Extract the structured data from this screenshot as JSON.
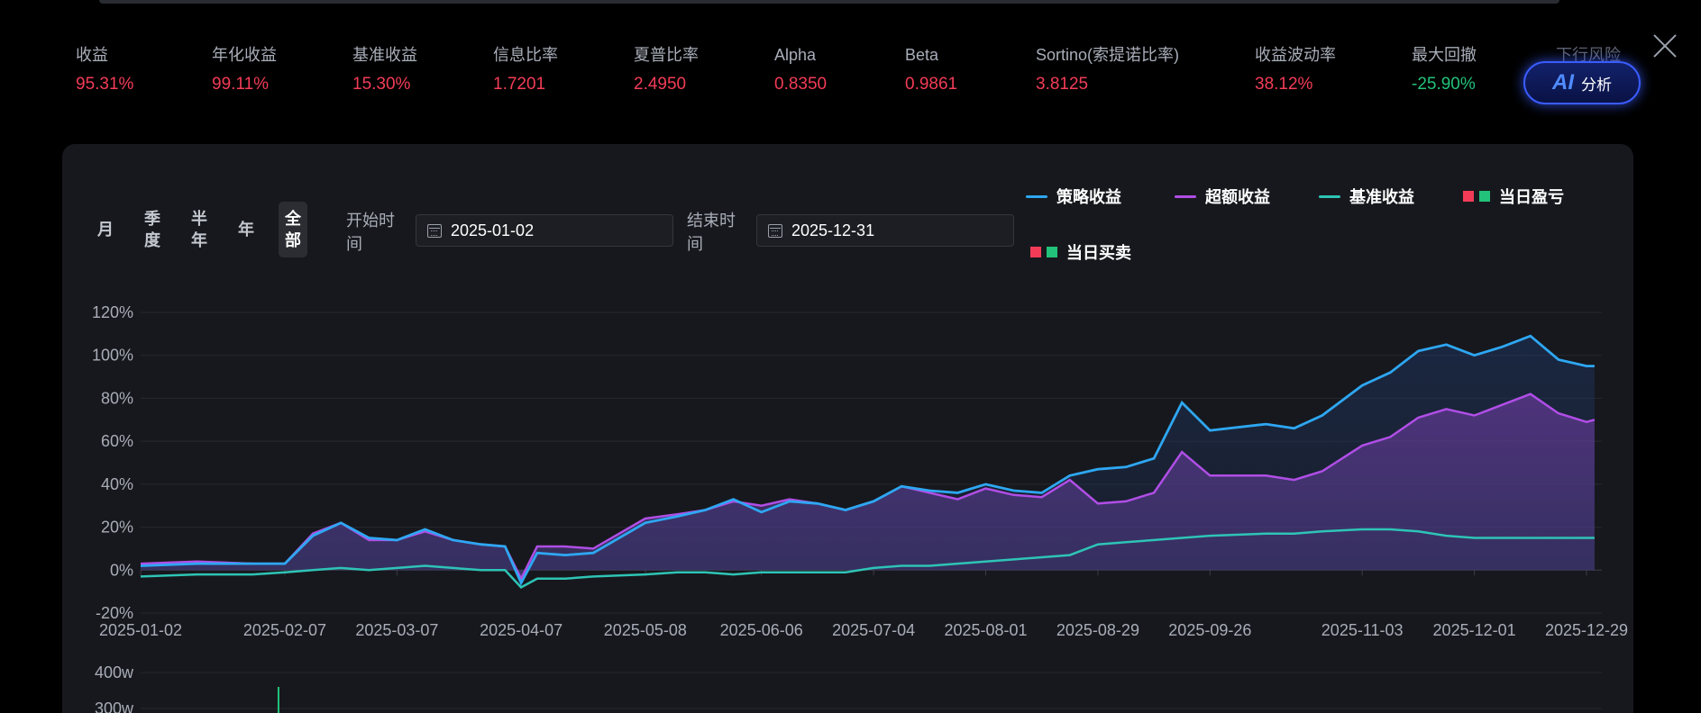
{
  "stats": [
    {
      "label": "收益",
      "value": "95.31%",
      "tone": "pos"
    },
    {
      "label": "年化收益",
      "value": "99.11%",
      "tone": "pos"
    },
    {
      "label": "基准收益",
      "value": "15.30%",
      "tone": "pos"
    },
    {
      "label": "信息比率",
      "value": "1.7201",
      "tone": "pos"
    },
    {
      "label": "夏普比率",
      "value": "2.4950",
      "tone": "pos"
    },
    {
      "label": "Alpha",
      "value": "0.8350",
      "tone": "pos"
    },
    {
      "label": "Beta",
      "value": "0.9861",
      "tone": "pos"
    },
    {
      "label": "Sortino(索提诺比率)",
      "value": "3.8125",
      "tone": "pos"
    },
    {
      "label": "收益波动率",
      "value": "38.12%",
      "tone": "pos"
    },
    {
      "label": "最大回撤",
      "value": "-25.90%",
      "tone": "neg"
    },
    {
      "label": "下行风险",
      "value": "",
      "tone": "faded"
    }
  ],
  "ai_button": {
    "mark": "AI",
    "label": "分析"
  },
  "period_tabs": [
    {
      "label": "月",
      "active": false
    },
    {
      "label": "季度",
      "active": false
    },
    {
      "label": "半年",
      "active": false
    },
    {
      "label": "年",
      "active": false
    },
    {
      "label": "全部",
      "active": true
    }
  ],
  "date_range": {
    "start_label": "开始时间",
    "start_value": "2025-01-02",
    "end_label": "结束时间",
    "end_value": "2025-12-31"
  },
  "legend": [
    {
      "name": "策略收益",
      "kind": "line",
      "color": "#2ea7f2"
    },
    {
      "name": "超额收益",
      "kind": "line",
      "color": "#b04ee6"
    },
    {
      "name": "基准收益",
      "kind": "line",
      "color": "#2ec4b6"
    },
    {
      "name": "当日盈亏",
      "kind": "squares",
      "colors": [
        "#f23c57",
        "#22c27a"
      ]
    },
    {
      "name": "当日买卖",
      "kind": "squares",
      "colors": [
        "#f23c57",
        "#22c27a"
      ]
    }
  ],
  "colors": {
    "strategy": "#2ea7f2",
    "excess": "#b04ee6",
    "benchmark": "#2ec4b6",
    "positive": "#f23c57",
    "negative": "#22c27a"
  },
  "chart_data": {
    "type": "line",
    "x_ticks": [
      "2025-01-02",
      "2025-02-07",
      "2025-03-07",
      "2025-04-07",
      "2025-05-08",
      "2025-06-06",
      "2025-07-04",
      "2025-08-01",
      "2025-08-29",
      "2025-09-26",
      "2025-11-03",
      "2025-12-01",
      "2025-12-29"
    ],
    "y_ticks": [
      "120%",
      "100%",
      "80%",
      "60%",
      "40%",
      "20%",
      "0%",
      "-20%"
    ],
    "ylim": [
      -20,
      120
    ],
    "grid": true,
    "x": [
      "2025-01-02",
      "2025-01-16",
      "2025-01-30",
      "2025-02-07",
      "2025-02-14",
      "2025-02-21",
      "2025-02-28",
      "2025-03-07",
      "2025-03-14",
      "2025-03-21",
      "2025-03-28",
      "2025-04-03",
      "2025-04-07",
      "2025-04-11",
      "2025-04-18",
      "2025-04-25",
      "2025-05-08",
      "2025-05-16",
      "2025-05-23",
      "2025-05-30",
      "2025-06-06",
      "2025-06-13",
      "2025-06-20",
      "2025-06-27",
      "2025-07-04",
      "2025-07-11",
      "2025-07-18",
      "2025-07-25",
      "2025-08-01",
      "2025-08-08",
      "2025-08-15",
      "2025-08-22",
      "2025-08-29",
      "2025-09-05",
      "2025-09-12",
      "2025-09-19",
      "2025-09-26",
      "2025-10-10",
      "2025-10-17",
      "2025-10-24",
      "2025-11-03",
      "2025-11-10",
      "2025-11-17",
      "2025-11-24",
      "2025-12-01",
      "2025-12-08",
      "2025-12-15",
      "2025-12-22",
      "2025-12-29",
      "2025-12-31"
    ],
    "series": [
      {
        "name": "策略收益",
        "values": [
          2,
          3,
          3,
          3,
          16,
          22,
          15,
          14,
          19,
          14,
          12,
          11,
          -6,
          8,
          7,
          8,
          22,
          25,
          28,
          33,
          27,
          32,
          31,
          28,
          32,
          39,
          37,
          36,
          40,
          37,
          36,
          44,
          47,
          48,
          52,
          78,
          65,
          68,
          66,
          72,
          86,
          92,
          102,
          105,
          100,
          104,
          109,
          98,
          95,
          95
        ]
      },
      {
        "name": "超额收益",
        "values": [
          3,
          4,
          3,
          3,
          17,
          22,
          14,
          14,
          18,
          14,
          12,
          11,
          -4,
          11,
          11,
          10,
          24,
          26,
          28,
          32,
          30,
          33,
          31,
          28,
          32,
          39,
          36,
          33,
          38,
          35,
          34,
          42,
          31,
          32,
          36,
          55,
          44,
          44,
          42,
          46,
          58,
          62,
          71,
          75,
          72,
          77,
          82,
          73,
          69,
          70
        ]
      },
      {
        "name": "基准收益",
        "values": [
          -3,
          -2,
          -2,
          -1,
          0,
          1,
          0,
          1,
          2,
          1,
          0,
          0,
          -8,
          -4,
          -4,
          -3,
          -2,
          -1,
          -1,
          -2,
          -1,
          -1,
          -1,
          -1,
          1,
          2,
          2,
          3,
          4,
          5,
          6,
          7,
          12,
          13,
          14,
          15,
          16,
          17,
          17,
          18,
          19,
          19,
          18,
          16,
          15,
          15,
          15,
          15,
          15,
          15
        ]
      }
    ],
    "sub_axis_ticks": [
      "400w",
      "300w"
    ],
    "sub_bars": [
      {
        "x": "2025-02-07",
        "value": 360,
        "color": "#22c27a"
      }
    ]
  }
}
